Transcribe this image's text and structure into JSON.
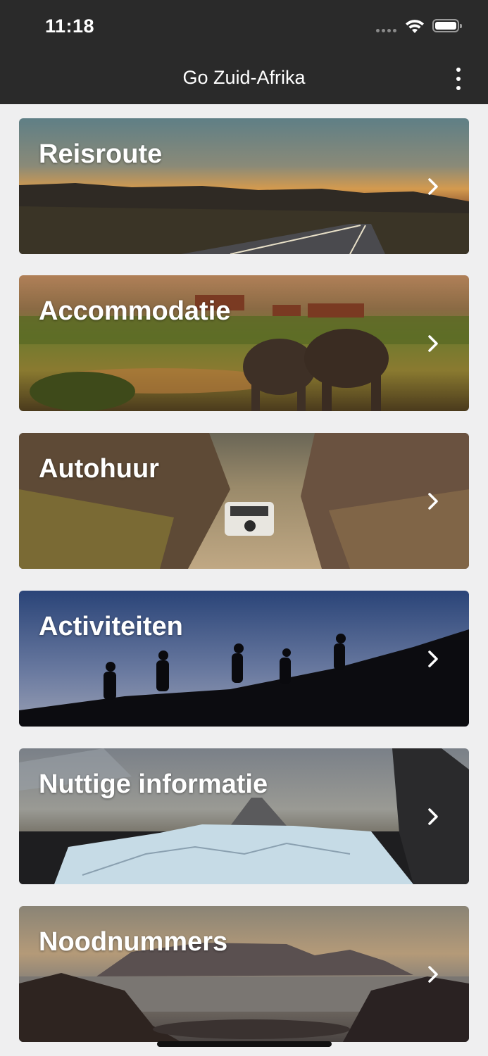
{
  "status_bar": {
    "time": "11:18"
  },
  "nav": {
    "title": "Go Zuid-Afrika"
  },
  "menu": [
    {
      "label": "Reisroute"
    },
    {
      "label": "Accommodatie"
    },
    {
      "label": "Autohuur"
    },
    {
      "label": "Activiteiten"
    },
    {
      "label": "Nuttige informatie"
    },
    {
      "label": "Noodnummers"
    }
  ],
  "icons": {
    "status": [
      "cellular-signal-icon",
      "wifi-icon",
      "battery-icon"
    ],
    "nav": "more-vertical-icon",
    "card": "chevron-right-icon"
  }
}
